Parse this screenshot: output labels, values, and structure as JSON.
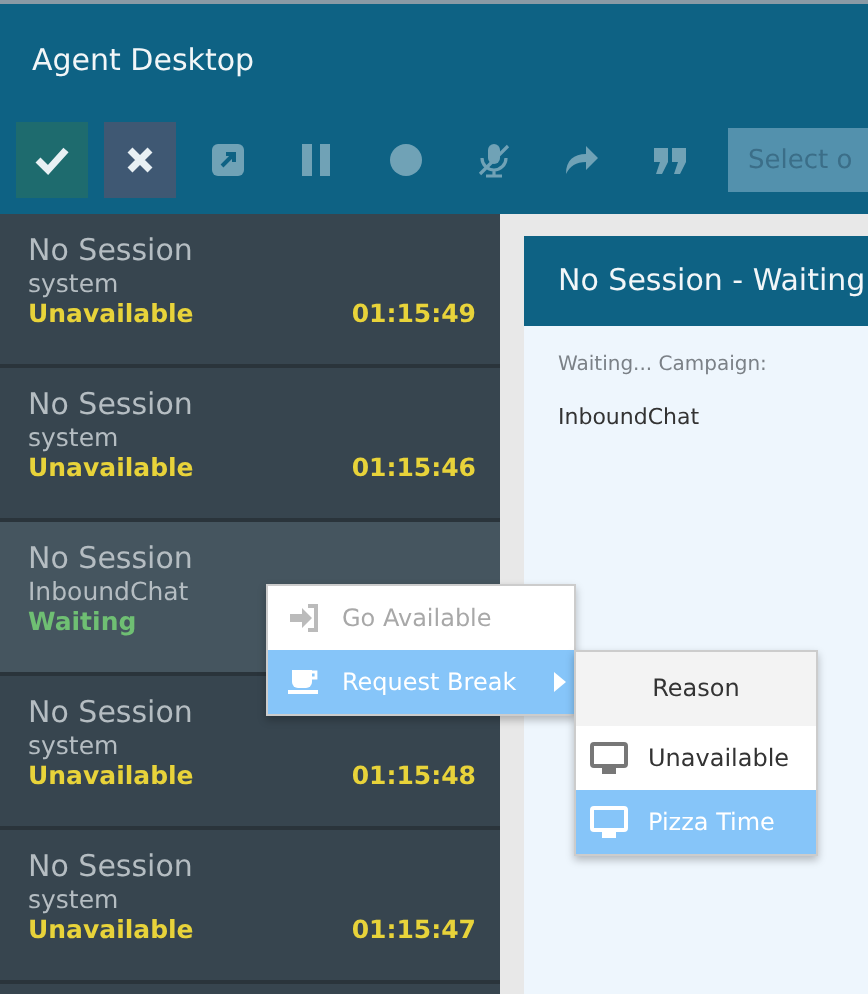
{
  "window": {
    "title": "Agent Desktop"
  },
  "toolbar": {
    "buttons": [
      {
        "kind": "accept",
        "disabled": false
      },
      {
        "kind": "reject",
        "disabled": false
      },
      {
        "kind": "transfer",
        "disabled": true
      },
      {
        "kind": "hold",
        "disabled": true
      },
      {
        "kind": "record",
        "disabled": true
      },
      {
        "kind": "mute",
        "disabled": true
      },
      {
        "kind": "forward",
        "disabled": true
      },
      {
        "kind": "canned",
        "disabled": true
      }
    ],
    "select": {
      "placeholder": "Select o"
    }
  },
  "sessions": [
    {
      "name": "No Session",
      "source": "system",
      "status": "Unavailable",
      "color": "#e8d33a",
      "time": "01:15:49",
      "selected": false
    },
    {
      "name": "No Session",
      "source": "system",
      "status": "Unavailable",
      "color": "#e8d33a",
      "time": "01:15:46",
      "selected": false
    },
    {
      "name": "No Session",
      "source": "InboundChat",
      "status": "Waiting",
      "color": "#6fbf73",
      "selected": true
    },
    {
      "name": "No Session",
      "source": "system",
      "status": "Unavailable",
      "color": "#e8d33a",
      "time": "01:15:48",
      "selected": false
    },
    {
      "name": "No Session",
      "source": "system",
      "status": "Unavailable",
      "color": "#e8d33a",
      "time": "01:15:47",
      "selected": false
    }
  ],
  "detail": {
    "title": "No Session - Waiting",
    "label": "Waiting... Campaign:",
    "value": "InboundChat"
  },
  "context_menu": {
    "items": [
      {
        "label": "Go Available",
        "kind": "available",
        "disabled": true,
        "selected": false
      },
      {
        "label": "Request Break",
        "kind": "break",
        "disabled": false,
        "selected": true,
        "submenu": true
      }
    ]
  },
  "submenu": {
    "header": "Reason",
    "items": [
      {
        "label": "Unavailable",
        "selected": false
      },
      {
        "label": "Pizza Time",
        "selected": true
      }
    ]
  }
}
